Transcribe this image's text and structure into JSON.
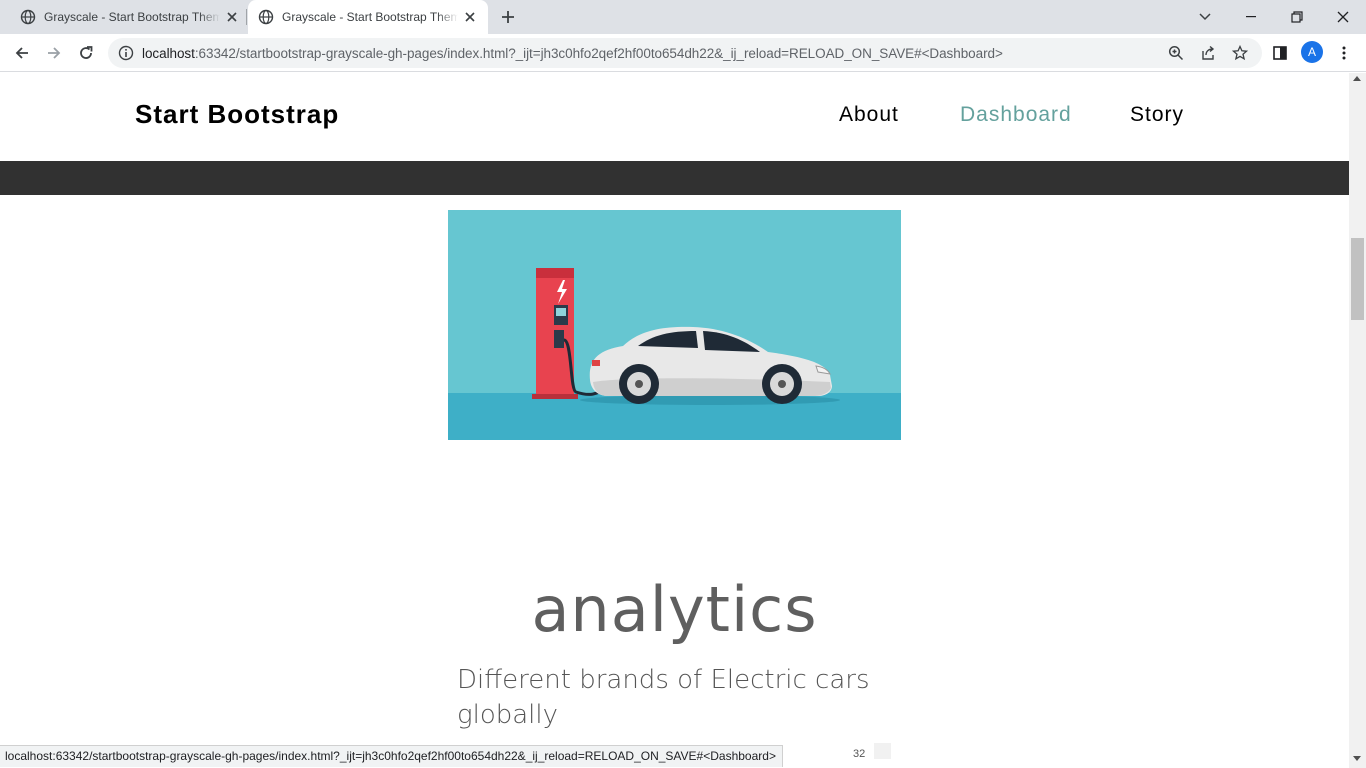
{
  "browser": {
    "tabs": [
      {
        "title": "Grayscale - Start Bootstrap Theme",
        "active": false
      },
      {
        "title": "Grayscale - Start Bootstrap Theme",
        "active": true
      }
    ],
    "url_host": "localhost",
    "url_rest": ":63342/startbootstrap-grayscale-gh-pages/index.html?_ijt=jh3c0hfo2qef2hf00to654dh22&_ij_reload=RELOAD_ON_SAVE#<Dashboard>",
    "profile_initial": "A",
    "status_url": "localhost:63342/startbootstrap-grayscale-gh-pages/index.html?_ijt=jh3c0hfo2qef2hf00to654dh22&_ij_reload=RELOAD_ON_SAVE#<Dashboard>"
  },
  "site": {
    "brand": "Start Bootstrap",
    "nav": [
      {
        "label": "About",
        "active": false
      },
      {
        "label": "Dashboard",
        "active": true
      },
      {
        "label": "Story",
        "active": false
      }
    ],
    "accent_color": "#64a19d",
    "band_color": "#313131"
  },
  "section": {
    "title": "analytics",
    "text": "Different brands of Electric cars globally",
    "stray_number": "32"
  },
  "hero": {
    "sky_color": "#66c6d1",
    "ground_color": "#3eafc7",
    "charger_color": "#e8434f"
  }
}
